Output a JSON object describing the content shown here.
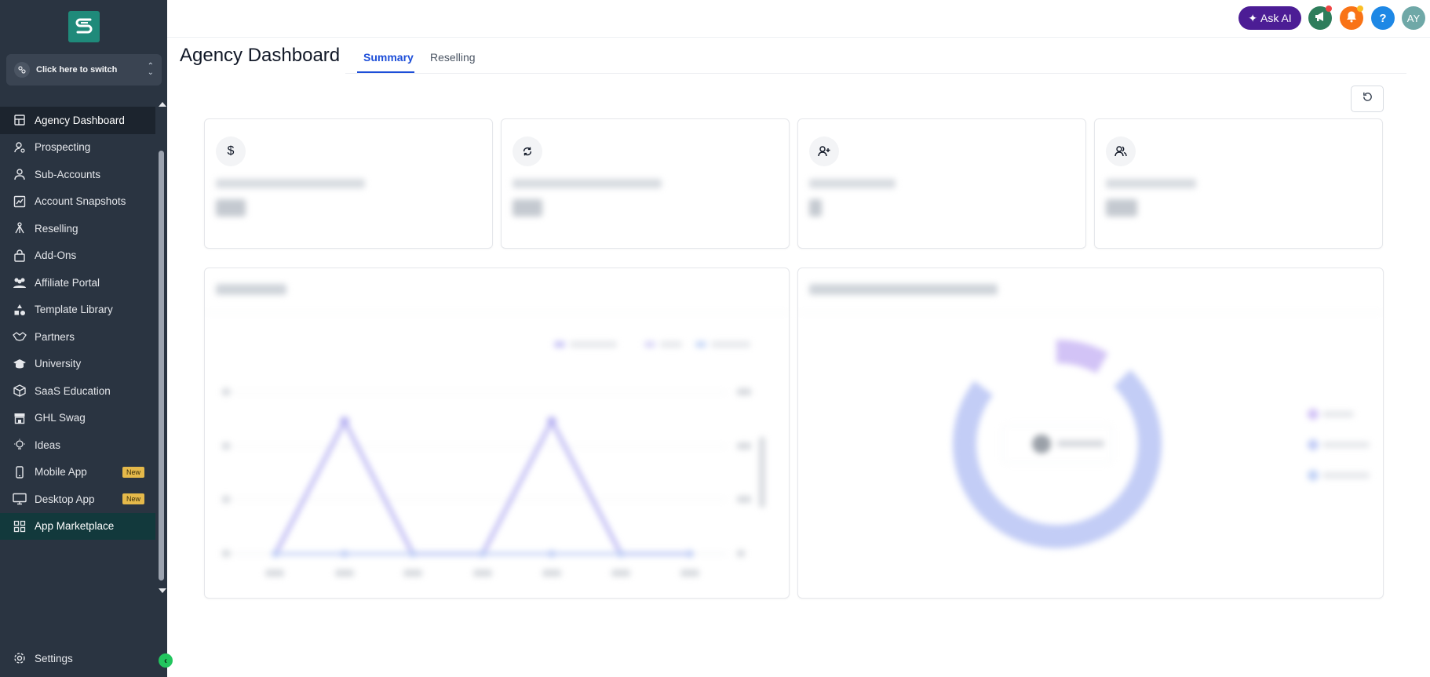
{
  "sidebar": {
    "switcher_label": "Click here to switch",
    "items": [
      {
        "label": "Agency Dashboard",
        "icon": "dashboard-icon"
      },
      {
        "label": "Prospecting",
        "icon": "prospecting-icon"
      },
      {
        "label": "Sub-Accounts",
        "icon": "user-icon"
      },
      {
        "label": "Account Snapshots",
        "icon": "snapshot-icon"
      },
      {
        "label": "Reselling",
        "icon": "reselling-icon"
      },
      {
        "label": "Add-Ons",
        "icon": "bag-icon"
      },
      {
        "label": "Affiliate Portal",
        "icon": "group-icon"
      },
      {
        "label": "Template Library",
        "icon": "shapes-icon"
      },
      {
        "label": "Partners",
        "icon": "handshake-icon"
      },
      {
        "label": "University",
        "icon": "graduation-cap-icon"
      },
      {
        "label": "SaaS Education",
        "icon": "box-icon"
      },
      {
        "label": "GHL Swag",
        "icon": "store-icon"
      },
      {
        "label": "Ideas",
        "icon": "lightbulb-icon"
      },
      {
        "label": "Mobile App",
        "icon": "mobile-icon",
        "badge": "New"
      },
      {
        "label": "Desktop App",
        "icon": "monitor-icon",
        "badge": "New"
      },
      {
        "label": "App Marketplace",
        "icon": "grid-icon"
      }
    ],
    "settings_label": "Settings"
  },
  "topbar": {
    "ask_ai_label": "Ask AI",
    "help_label": "?",
    "avatar_initials": "AY"
  },
  "page": {
    "title": "Agency Dashboard",
    "tabs": [
      {
        "label": "Summary",
        "active": true
      },
      {
        "label": "Reselling",
        "active": false
      }
    ]
  },
  "colors": {
    "sidebar_bg": "#2a3441",
    "accent_blue": "#1d4ed8",
    "ask_ai_bg": "#4c1d95",
    "announcement_green": "#2e7d5b",
    "notification_orange": "#f97316",
    "help_blue": "#1e88e5",
    "avatar_teal": "#6fa8a7",
    "new_badge": "#e5b94a"
  }
}
